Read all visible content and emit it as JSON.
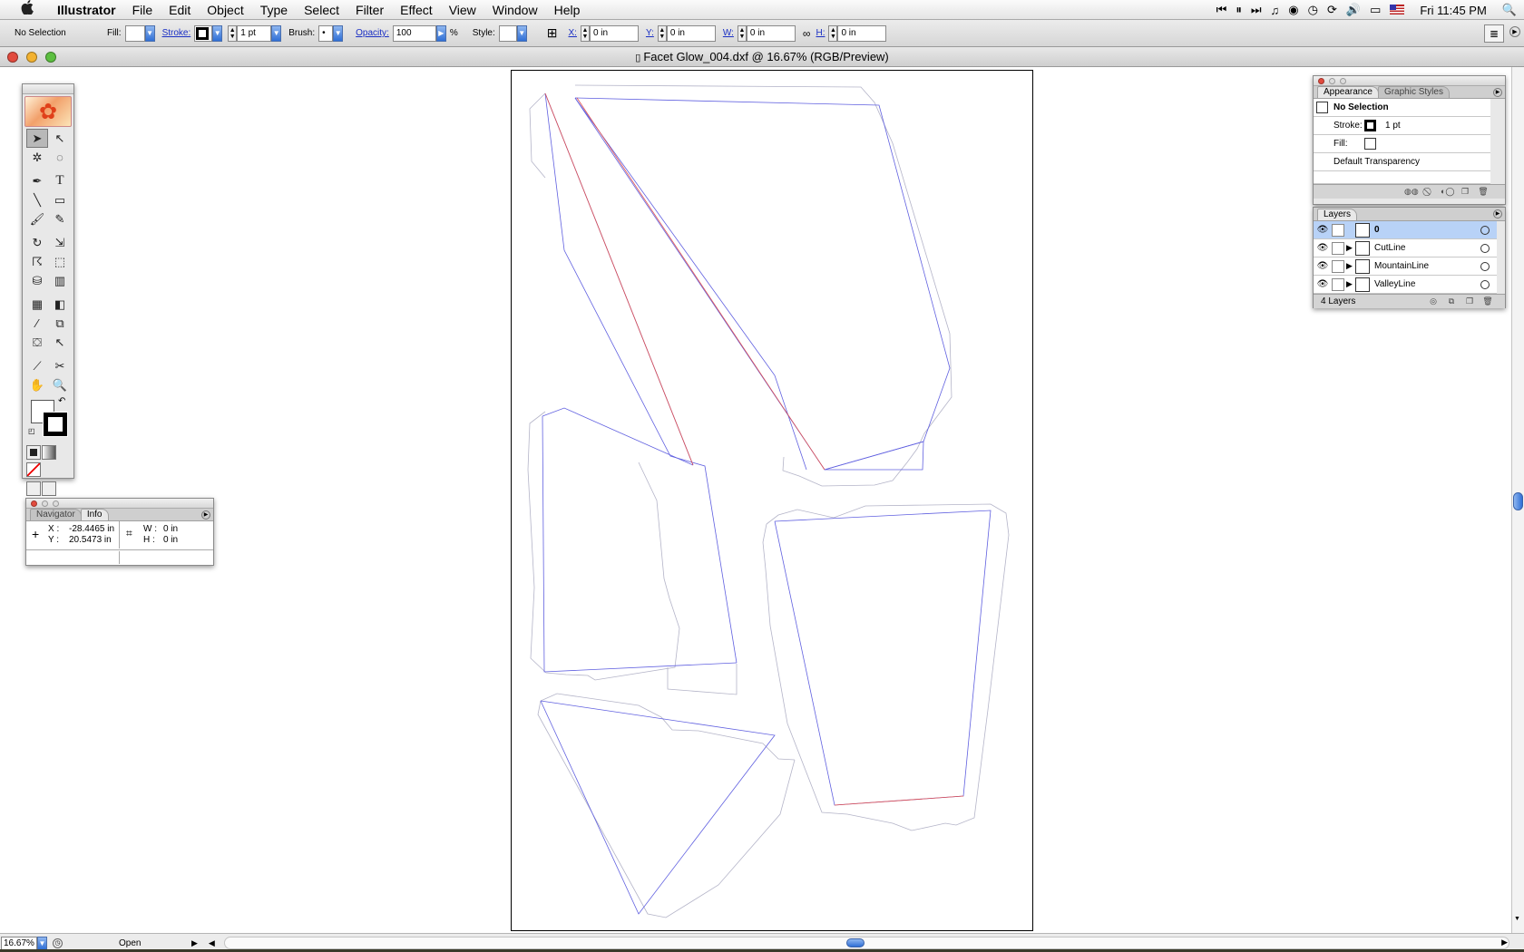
{
  "menubar": {
    "apple": "",
    "app_name": "Illustrator",
    "items": [
      "File",
      "Edit",
      "Object",
      "Type",
      "Select",
      "Filter",
      "Effect",
      "View",
      "Window",
      "Help"
    ],
    "clock": "Fri 11:45 PM",
    "status_icons": [
      "rewind-icon",
      "pause-icon",
      "forward-icon",
      "music-note-icon",
      "sync-icon",
      "time-machine-icon",
      "refresh-icon",
      "volume-icon",
      "display-icon",
      "us-flag-icon",
      "spotlight-icon"
    ]
  },
  "control": {
    "selection": "No Selection",
    "fill_label": "Fill:",
    "stroke_label": "Stroke:",
    "stroke_weight": "1 pt",
    "brush_label": "Brush:",
    "brush_value": "•",
    "opacity_label": "Opacity:",
    "opacity_value": "100",
    "opacity_unit": "%",
    "style_label": "Style:",
    "x_label": "X:",
    "x_value": "0 in",
    "y_label": "Y:",
    "y_value": "0 in",
    "w_label": "W:",
    "w_value": "0 in",
    "h_label": "H:",
    "h_value": "0 in"
  },
  "window": {
    "title": "Facet Glow_004.dxf @ 16.67% (RGB/Preview)"
  },
  "colors": {
    "cut_line": "#b4b4c8",
    "mountain_line": "#6060e0",
    "valley_line": "#e05050",
    "accent_blue": "#2f6fd6"
  },
  "info_panel": {
    "tabs": [
      "Navigator",
      "Info"
    ],
    "active_tab": "Info",
    "x_label": "X :",
    "x_value": "-28.4465 in",
    "y_label": "Y :",
    "y_value": "20.5473 in",
    "w_label": "W :",
    "w_value": "0 in",
    "h_label": "H :",
    "h_value": "0 in"
  },
  "appearance_panel": {
    "tabs": [
      "Appearance",
      "Graphic Styles"
    ],
    "active_tab": "Appearance",
    "header": "No Selection",
    "stroke_label": "Stroke:",
    "stroke_value": "1 pt",
    "fill_label": "Fill:",
    "transparency": "Default Transparency"
  },
  "layers_panel": {
    "tab": "Layers",
    "layers": [
      {
        "name": "0",
        "selected": true,
        "expandable": false
      },
      {
        "name": "CutLine",
        "selected": false,
        "expandable": true
      },
      {
        "name": "MountainLine",
        "selected": false,
        "expandable": true
      },
      {
        "name": "ValleyLine",
        "selected": false,
        "expandable": true
      }
    ],
    "count": "4 Layers"
  },
  "status": {
    "zoom": "16.67%",
    "state": "Open"
  }
}
